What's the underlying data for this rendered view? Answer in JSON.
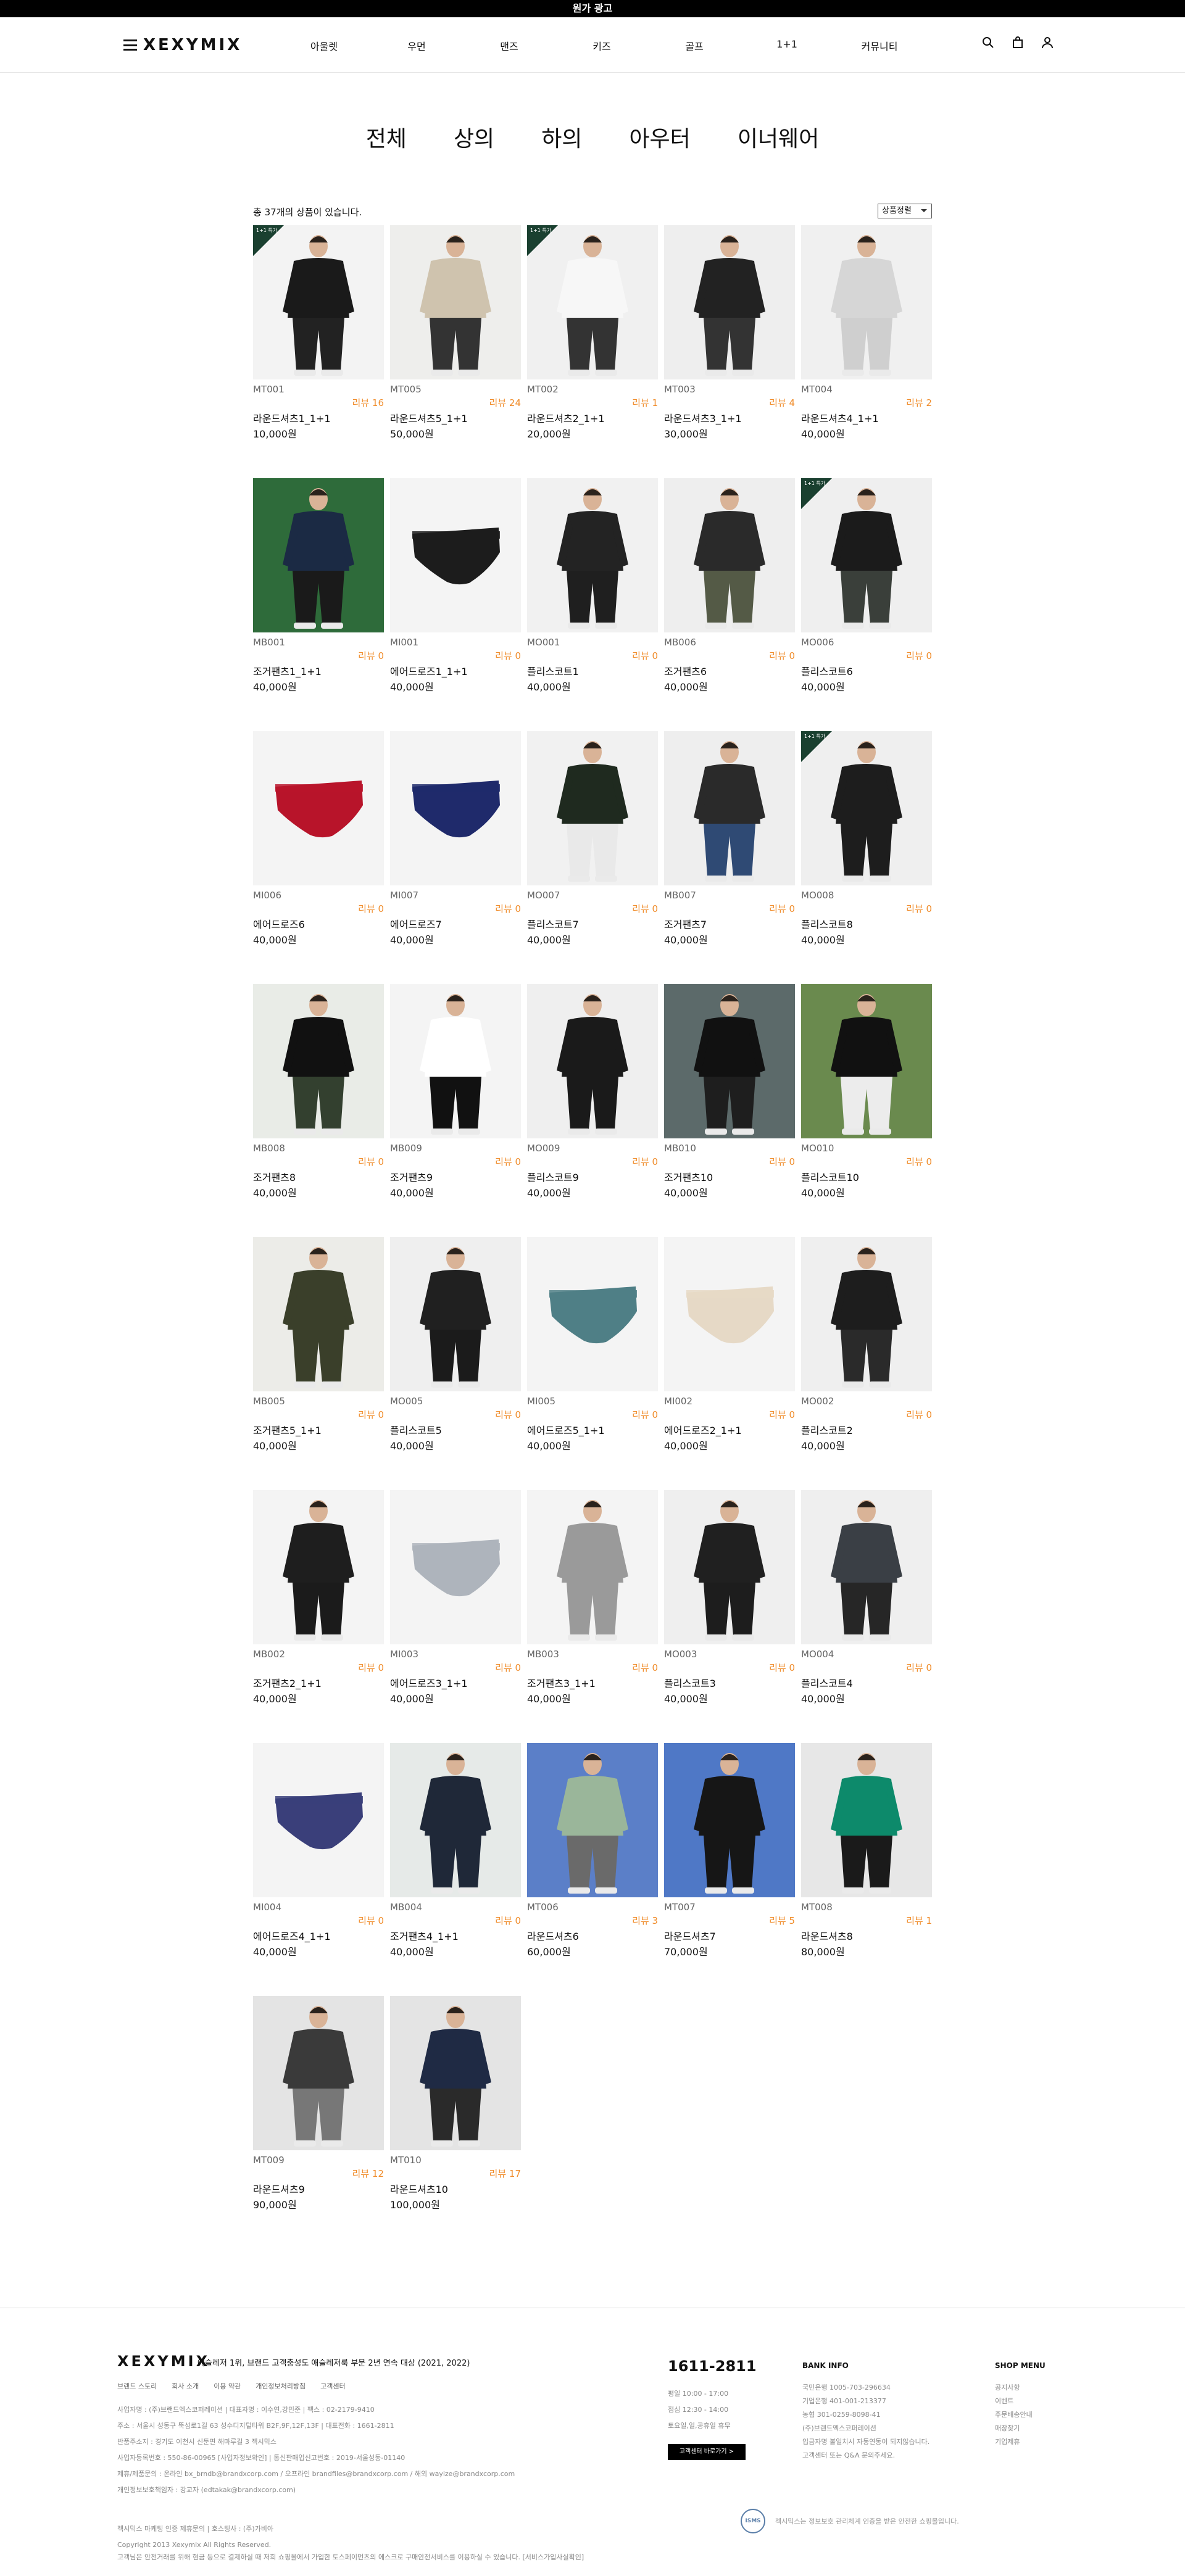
{
  "topbar": {
    "text": "원가 광고"
  },
  "header": {
    "logo": "XEXYMIX",
    "nav": [
      "아울렛",
      "우먼",
      "맨즈",
      "키즈",
      "골프",
      "1+1",
      "커뮤니티"
    ]
  },
  "categories": [
    "전체",
    "상의",
    "하의",
    "아우터",
    "이너웨어"
  ],
  "listing": {
    "count_text": "총 37개의 상품이 있습니다.",
    "sort_label": "상품정렬",
    "badge_text": "1+1 특가"
  },
  "products": [
    {
      "code": "MT001",
      "review": "리뷰 16",
      "name": "라운드셔츠1_1+1",
      "price": "10,000원",
      "badge": true,
      "img": "sweat-black",
      "bg": "#f3f3f3"
    },
    {
      "code": "MT005",
      "review": "리뷰 24",
      "name": "라운드셔츠5_1+1",
      "price": "50,000원",
      "badge": false,
      "img": "sweat-beige",
      "bg": "#eeeeec"
    },
    {
      "code": "MT002",
      "review": "리뷰 1",
      "name": "라운드셔츠2_1+1",
      "price": "20,000원",
      "badge": true,
      "img": "hood-white",
      "bg": "#f0f0f0"
    },
    {
      "code": "MT003",
      "review": "리뷰 4",
      "name": "라운드셔츠3_1+1",
      "price": "30,000원",
      "badge": false,
      "img": "sweat-dark",
      "bg": "#eeeeee"
    },
    {
      "code": "MT004",
      "review": "리뷰 2",
      "name": "라운드셔츠4_1+1",
      "price": "40,000원",
      "badge": false,
      "img": "hood-grey",
      "bg": "#f0f0f0"
    },
    {
      "code": "MB001",
      "review": "리뷰 0",
      "name": "조거팬츠1_1+1",
      "price": "40,000원",
      "badge": false,
      "img": "pants-field",
      "bg": "#2e6b3a"
    },
    {
      "code": "MI001",
      "review": "리뷰 0",
      "name": "에어드로즈1_1+1",
      "price": "40,000원",
      "badge": false,
      "img": "brief-black",
      "bg": "#f4f4f4"
    },
    {
      "code": "MO001",
      "review": "리뷰 0",
      "name": "플리스코트1",
      "price": "40,000원",
      "badge": false,
      "img": "coat-black",
      "bg": "#f1f1f1"
    },
    {
      "code": "MB006",
      "review": "리뷰 0",
      "name": "조거팬츠6",
      "price": "40,000원",
      "badge": false,
      "img": "pants-olive",
      "bg": "#eeeeee"
    },
    {
      "code": "MO006",
      "review": "리뷰 0",
      "name": "플리스코트6",
      "price": "40,000원",
      "badge": true,
      "img": "jacket-black",
      "bg": "#efefef"
    },
    {
      "code": "MI006",
      "review": "리뷰 0",
      "name": "에어드로즈6",
      "price": "40,000원",
      "badge": false,
      "img": "brief-red",
      "bg": "#f4f4f4"
    },
    {
      "code": "MI007",
      "review": "리뷰 0",
      "name": "에어드로즈7",
      "price": "40,000원",
      "badge": false,
      "img": "brief-navy",
      "bg": "#f4f4f4"
    },
    {
      "code": "MO007",
      "review": "리뷰 0",
      "name": "플리스코트7",
      "price": "40,000원",
      "badge": false,
      "img": "vest-khaki",
      "bg": "#f1f1f1"
    },
    {
      "code": "MB007",
      "review": "리뷰 0",
      "name": "조거팬츠7",
      "price": "40,000원",
      "badge": false,
      "img": "pants-blue",
      "bg": "#eeeeee"
    },
    {
      "code": "MO008",
      "review": "리뷰 0",
      "name": "플리스코트8",
      "price": "40,000원",
      "badge": true,
      "img": "hood-black",
      "bg": "#efefef"
    },
    {
      "code": "MB008",
      "review": "리뷰 0",
      "name": "조거팬츠8",
      "price": "40,000원",
      "badge": false,
      "img": "tee-black-model",
      "bg": "#e9ece7"
    },
    {
      "code": "MB009",
      "review": "리뷰 0",
      "name": "조거팬츠9",
      "price": "40,000원",
      "badge": false,
      "img": "leggings",
      "bg": "#f4f4f4"
    },
    {
      "code": "MO009",
      "review": "리뷰 0",
      "name": "플리스코트9",
      "price": "40,000원",
      "badge": false,
      "img": "jacket-black2",
      "bg": "#efefef"
    },
    {
      "code": "MB010",
      "review": "리뷰 0",
      "name": "조거팬츠10",
      "price": "40,000원",
      "badge": false,
      "img": "sit-model",
      "bg": "#5c6a6a"
    },
    {
      "code": "MO010",
      "review": "리뷰 0",
      "name": "플리스코트10",
      "price": "40,000원",
      "badge": false,
      "img": "golf-model",
      "bg": "#6a8a4e"
    },
    {
      "code": "MB005",
      "review": "리뷰 0",
      "name": "조거팬츠5_1+1",
      "price": "40,000원",
      "badge": false,
      "img": "khaki-set",
      "bg": "#ecece8"
    },
    {
      "code": "MO005",
      "review": "리뷰 0",
      "name": "플리스코트5",
      "price": "40,000원",
      "badge": false,
      "img": "jacket-black3",
      "bg": "#efefef"
    },
    {
      "code": "MI005",
      "review": "리뷰 0",
      "name": "에어드로즈5_1+1",
      "price": "40,000원",
      "badge": false,
      "img": "brief-teal",
      "bg": "#f4f4f4"
    },
    {
      "code": "MI002",
      "review": "리뷰 0",
      "name": "에어드로즈2_1+1",
      "price": "40,000원",
      "badge": false,
      "img": "brief-beige",
      "bg": "#f4f4f4"
    },
    {
      "code": "MO002",
      "review": "리뷰 0",
      "name": "플리스코트2",
      "price": "40,000원",
      "badge": false,
      "img": "fleece-black",
      "bg": "#efefef"
    },
    {
      "code": "MB002",
      "review": "리뷰 0",
      "name": "조거팬츠2_1+1",
      "price": "40,000원",
      "badge": false,
      "img": "cargo-black",
      "bg": "#f4f4f4"
    },
    {
      "code": "MI003",
      "review": "리뷰 0",
      "name": "에어드로즈3_1+1",
      "price": "40,000원",
      "badge": false,
      "img": "brief-grey",
      "bg": "#f4f4f4"
    },
    {
      "code": "MB003",
      "review": "리뷰 0",
      "name": "조거팬츠3_1+1",
      "price": "40,000원",
      "badge": false,
      "img": "pants-grey",
      "bg": "#f4f4f4"
    },
    {
      "code": "MO003",
      "review": "리뷰 0",
      "name": "플리스코트3",
      "price": "40,000원",
      "badge": false,
      "img": "hood-black2",
      "bg": "#efefef"
    },
    {
      "code": "MO004",
      "review": "리뷰 0",
      "name": "플리스코트4",
      "price": "40,000원",
      "badge": false,
      "img": "vest-grey",
      "bg": "#efefef"
    },
    {
      "code": "MI004",
      "review": "리뷰 0",
      "name": "에어드로즈4_1+1",
      "price": "40,000원",
      "badge": false,
      "img": "brief-navy2",
      "bg": "#f4f4f4"
    },
    {
      "code": "MB004",
      "review": "리뷰 0",
      "name": "조거팬츠4_1+1",
      "price": "40,000원",
      "badge": false,
      "img": "navy-set",
      "bg": "#e6eae8"
    },
    {
      "code": "MT006",
      "review": "리뷰 3",
      "name": "라운드셔츠6",
      "price": "60,000원",
      "badge": false,
      "img": "tee-mint",
      "bg": "#5b7fc8"
    },
    {
      "code": "MT007",
      "review": "리뷰 5",
      "name": "라운드셔츠7",
      "price": "70,000원",
      "badge": false,
      "img": "tee-black",
      "bg": "#4f78c6"
    },
    {
      "code": "MT008",
      "review": "리뷰 1",
      "name": "라운드셔츠8",
      "price": "80,000원",
      "badge": false,
      "img": "tee-green",
      "bg": "#e7e7e7"
    },
    {
      "code": "MT009",
      "review": "리뷰 12",
      "name": "라운드셔츠9",
      "price": "90,000원",
      "badge": false,
      "img": "tee-charcoal",
      "bg": "#e4e4e4"
    },
    {
      "code": "MT010",
      "review": "리뷰 17",
      "name": "라운드셔츠10",
      "price": "100,000원",
      "badge": false,
      "img": "tee-navy",
      "bg": "#e4e4e4"
    }
  ],
  "footer": {
    "logo": "XEXYMIX",
    "slogan": "애슬레저 1위, 브랜드 고객충성도 애슬레저룩 부문 2년 연속 대상 (2021, 2022)",
    "links": [
      "브랜드 스토리",
      "회사 소개",
      "이용 약관",
      "개인정보처리방침",
      "고객센터"
    ],
    "info": [
      "사업자명 : (주)브랜드엑스코퍼레이션  |  대표자명 : 이수연,강민준  |  팩스 : 02-2179-9410",
      "주소 : 서울시 성동구 뚝섬로1길 63 성수디지털타워 B2F,9F,12F,13F  |  대표전화 : 1661-2811",
      "반품주소지 : 경기도 이천시 신둔면 해마루길 3 젝시믹스",
      "사업자등록번호 : 550-86-00965 [사업자정보확인]  |  통신판매업신고번호 : 2019-서울성동-01140",
      "제휴/제품문의 : 온라인 bx_brndb@brandxcorp.com / 오프라인 brandfiles@brandxcorp.com / 해외 wayize@brandxcorp.com",
      "개인정보보호책임자 : 강교자 (edtakak@brandxcorp.com)"
    ],
    "copy1": "젝시믹스 마케팅 인증 제휴문의 | 호스팅사 : (주)가비아",
    "copy2": "Copyright 2013 Xexymix All Rights Reserved.",
    "copy3": "고객님은 안전거래를 위해 현금 등으로 결제하실 때 저희 쇼핑몰에서 가입한 토스페이먼츠의 에스크로 구매안전서비스를 이용하실 수 있습니다. [서비스가입사실확인]",
    "cs": {
      "tel": "1611-2811",
      "hours": [
        "평일 10:00 - 17:00",
        "점심 12:30 - 14:00",
        "토요일,일,공휴일 휴무"
      ],
      "button": "고객센터 바로가기 >"
    },
    "bank": {
      "title": "BANK INFO",
      "lines": [
        "국민은행 1005-703-296634",
        "기업은행 401-001-213377",
        "농협 301-0259-8098-41",
        "(주)브랜드엑스코퍼레이션",
        "입금자명 불일치시 자동연동이 되지않습니다.",
        "고객센터 또는 Q&A 문의주세요."
      ]
    },
    "shop": {
      "title": "SHOP MENU",
      "lines": [
        "공지사항",
        "이벤트",
        "주문배송안내",
        "매장찾기",
        "기업제휴"
      ]
    },
    "isms": {
      "seal": "ISMS",
      "text": "젝시믹스는 정보보호 관리체계 인증을 받은 안전한 쇼핑몰입니다."
    }
  }
}
